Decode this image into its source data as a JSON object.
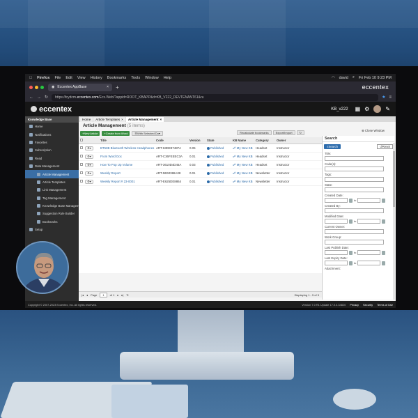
{
  "mac_menu": {
    "app": "Firefox",
    "items": [
      "File",
      "Edit",
      "View",
      "History",
      "Bookmarks",
      "Tools",
      "Window",
      "Help"
    ],
    "user": "david",
    "datetime": "Fri Feb 10  9:23 PM"
  },
  "browser": {
    "tab_title": "Eccentex AppBase",
    "url_prefix": "https://trydcm.",
    "url_domain": "eccentex.com",
    "url_rest": "/Ecx.Web/?appid=ROOT_KBAPP&d=KB_V222_DEVTENANT61&ru",
    "brand": "eccentex"
  },
  "app": {
    "kb_version": "KB_v222"
  },
  "sidebar": {
    "header": "Knowledge Base",
    "items": [
      {
        "label": "Home",
        "sub": false,
        "active": false
      },
      {
        "label": "Notifications",
        "sub": false,
        "active": false
      },
      {
        "label": "Favorites",
        "sub": false,
        "active": false
      },
      {
        "label": "Subscription",
        "sub": false,
        "active": false
      },
      {
        "label": "Read",
        "sub": false,
        "active": false
      },
      {
        "label": "Data Management",
        "sub": false,
        "active": false
      },
      {
        "label": "Article Management",
        "sub": true,
        "active": true
      },
      {
        "label": "Article Templates",
        "sub": true,
        "active": false
      },
      {
        "label": "Link Management",
        "sub": true,
        "active": false
      },
      {
        "label": "Tag Management",
        "sub": true,
        "active": false
      },
      {
        "label": "Knowledge Base Management",
        "sub": true,
        "active": false
      },
      {
        "label": "Suggestion Rule Builder",
        "sub": true,
        "active": false
      },
      {
        "label": "Bookmarks",
        "sub": true,
        "active": false
      },
      {
        "label": "Setup",
        "sub": false,
        "active": false
      }
    ]
  },
  "tabs": [
    "Home",
    "Article Templates",
    "Article Management"
  ],
  "page": {
    "title": "Article Management",
    "count": "(5 items)"
  },
  "toolbar": {
    "new_article": "New Article",
    "create_word": "Create from Word",
    "with_selected": "With Selected Do",
    "recalc": "Recalculate bookmarks",
    "export": "Export/Import"
  },
  "table": {
    "headers": [
      "Title",
      "Code",
      "Version",
      "State",
      "KB Name",
      "Category",
      "Owner"
    ],
    "rows": [
      [
        "BT53B Bluetooth Wireless Headphones",
        "ART-63DE97487A",
        "0.05",
        "Published",
        "My New KB",
        "Headset",
        "Instructor"
      ],
      [
        "From Word Doc",
        "ART-C36FEEEC3A",
        "0.01",
        "Published",
        "My New KB",
        "Headset",
        "Instructor"
      ],
      [
        "How To Pop Up Volume",
        "ART-3610D4D46A",
        "0.03",
        "Published",
        "My New KB",
        "Headset",
        "Instructor"
      ],
      [
        "Weekly Report",
        "ART-5E60386A38",
        "0.01",
        "Published",
        "My New KB",
        "Newsletter",
        "Instructor"
      ],
      [
        "Weekly Report # 23-0001",
        "ART-E625DE8864",
        "0.01",
        "Published",
        "My New KB",
        "Newsletter",
        "Instructor"
      ]
    ]
  },
  "pager": {
    "page_label": "Page",
    "page_value": "1",
    "of": "of 1",
    "displaying": "Displaying 1 - 5 of 5"
  },
  "search": {
    "close_window": "Close Window",
    "title": "Search",
    "search_btn": "Search",
    "reset_btn": "Reset",
    "to": "to",
    "fields": [
      "Title:",
      "Code(s):",
      "Tags:",
      "State:",
      "Created Date:",
      "Created By:",
      "Modified Date:",
      "Current Owner:",
      "Work Group:",
      "Last Publish Date:",
      "Last Expiry Date:",
      "Attachment:"
    ]
  },
  "footer": {
    "copyright": "Copyright © 2007-2023 Eccentex, Inc. All rights reserved.",
    "version": "Version  7.0 R1 Update 17.0.4.34820",
    "privacy": "Privacy",
    "security": "Security",
    "terms": "Terms of Use"
  },
  "colors": {
    "accent_green": "#3b8f43",
    "accent_blue": "#2e6dad",
    "sidebar_active": "#3a6ea5",
    "background": "#1b3e66"
  }
}
